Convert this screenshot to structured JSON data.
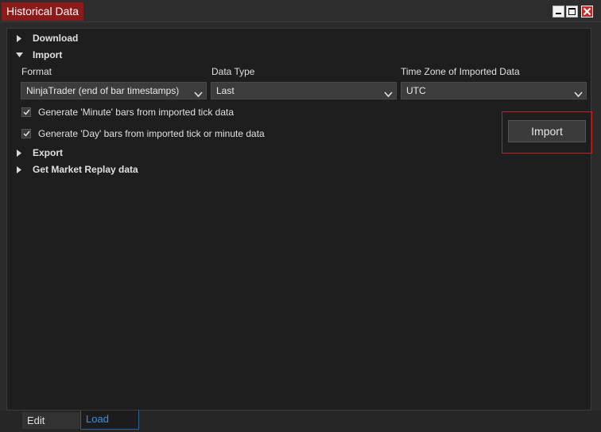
{
  "window": {
    "title": "Historical Data",
    "controls": [
      "minimize-icon",
      "maximize-icon",
      "close-icon"
    ]
  },
  "sections": {
    "download": {
      "label": "Download",
      "expanded": false
    },
    "import": {
      "label": "Import",
      "expanded": true
    },
    "export": {
      "label": "Export",
      "expanded": false
    },
    "market_replay": {
      "label": "Get Market Replay data",
      "expanded": false
    }
  },
  "import_form": {
    "format_label": "Format",
    "format_value": "NinjaTrader (end of bar timestamps)",
    "data_type_label": "Data Type",
    "data_type_value": "Last",
    "timezone_label": "Time Zone of Imported Data",
    "timezone_value": "UTC",
    "minute_bars_label": "Generate 'Minute' bars from imported tick data",
    "minute_bars_checked": true,
    "day_bars_label": "Generate 'Day' bars from imported tick or minute data",
    "day_bars_checked": true,
    "import_button": "Import"
  },
  "bottom_tabs": {
    "edit": "Edit",
    "load": "Load",
    "active": "load"
  },
  "colors": {
    "title_tab": "#8b1a1a",
    "highlight_border": "#c41e1e",
    "active_tab_text": "#3a8ee6",
    "panel_bg": "#1e1e1e"
  }
}
